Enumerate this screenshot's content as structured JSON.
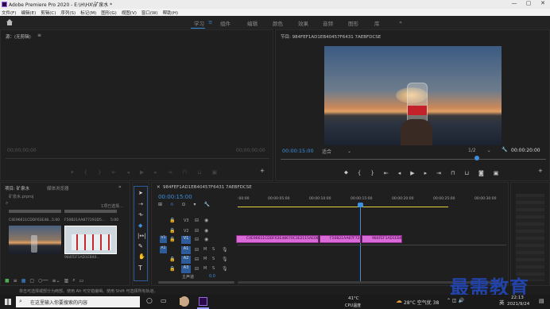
{
  "window": {
    "title": "Adobe Premiere Pro 2020 - E:\\H\\HX\\矿泉水 *",
    "min": "—",
    "max": "▢",
    "close": "✕"
  },
  "menu": [
    "文件(F)",
    "编辑(E)",
    "剪辑(C)",
    "序列(S)",
    "标记(M)",
    "图形(G)",
    "视图(V)",
    "窗口(W)",
    "帮助(H)"
  ],
  "workspaces": [
    "学习",
    "组件",
    "编辑",
    "颜色",
    "效果",
    "音频",
    "图形",
    "库"
  ],
  "workspace_more": "»",
  "source": {
    "title": "源：(无剪辑)",
    "tc_left": "00;00;00;00",
    "tc_right": "00;00;00;00"
  },
  "program": {
    "title": "节目: 984FEF1AD1EB40457F6431 7AEBFDCSE",
    "tc_left": "00:00:15:00",
    "fit": "适合",
    "quality": "1/2",
    "tc_right": "00:00:20:00"
  },
  "project": {
    "tab1": "项目: 矿泉水",
    "tab2": "媒体浏览器",
    "file": "矿泉水.prproj",
    "selected": "1项已选择...",
    "items": [
      {
        "name": "C4E96611CDDF63E48...",
        "dur": "5:00"
      },
      {
        "name": "F50B21AA877293D5...",
        "dur": "5:00"
      },
      {
        "name": "984FEF1AD1EB40...",
        "dur": "5:00"
      }
    ]
  },
  "timeline": {
    "tab": "984FEF1AD1EB40457F6431 7AEBFDCSE",
    "tc": "00:00:15:00",
    "ruler": [
      ":00:00",
      "00:00:05:00",
      "00:00:10:00",
      "00:00:15:00",
      "00:00:20:00",
      "00:00:25:00",
      "00:00:30:00"
    ],
    "tracks": [
      {
        "id": "V3",
        "kind": "video"
      },
      {
        "id": "V2",
        "kind": "video"
      },
      {
        "id": "V1",
        "kind": "video"
      },
      {
        "id": "A1",
        "kind": "audio",
        "m": "M",
        "s": "S"
      },
      {
        "id": "A2",
        "kind": "audio",
        "m": "M",
        "s": "S"
      },
      {
        "id": "A3",
        "kind": "audio",
        "m": "M",
        "s": "S"
      }
    ],
    "master": "主声道",
    "master_val": "0.0",
    "clips": [
      "C4E96611CDDF63E48670C3E2115AE08.jpg",
      "F50B21AA87F729309...",
      "984FEF1AD1EB40..."
    ]
  },
  "status": "单击可选择或部分为两部。使用 Alt 可交错编缉。使用 Shift 可选择所有轨道。",
  "taskbar": {
    "search": "在这里输入你要搜索的内容",
    "temp": "41°C",
    "temp_label": "CPU温度",
    "weather": "28°C 空气优 38",
    "lang": "英",
    "time": "22:13",
    "date": "2021/9/24"
  },
  "watermark": "最需教育",
  "colors": {
    "accent": "#3d8fe0",
    "clip": "#d96ad8"
  }
}
